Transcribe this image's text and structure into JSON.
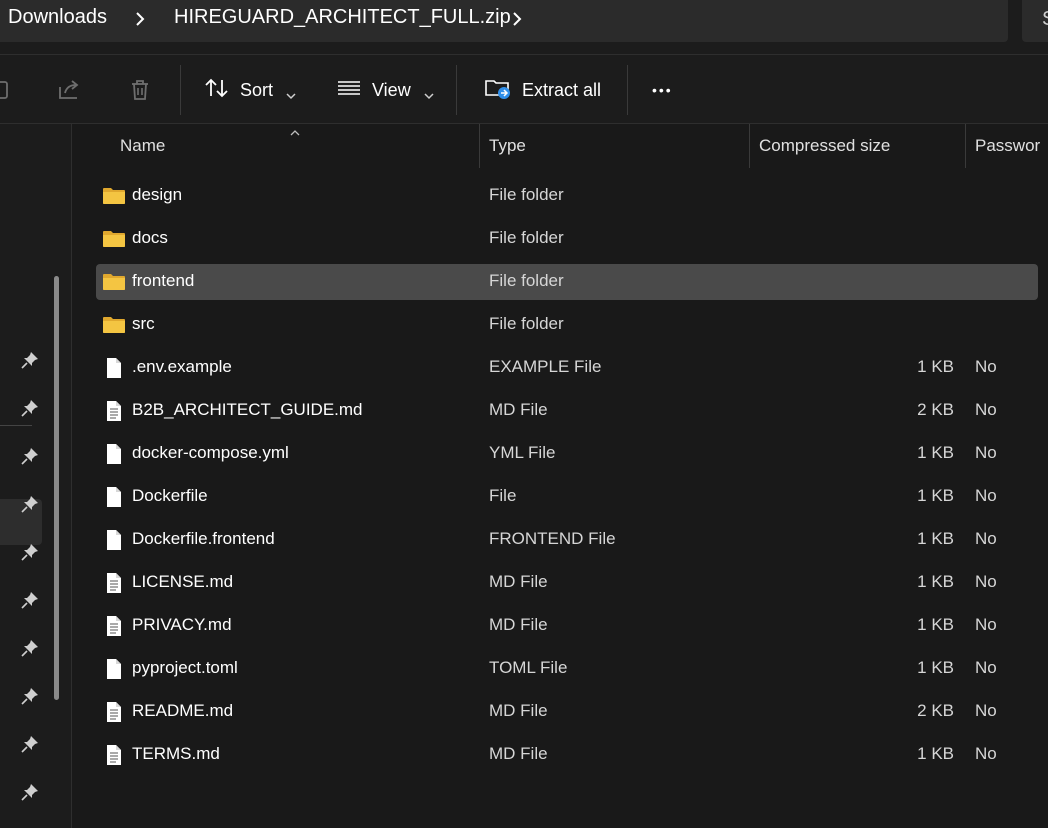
{
  "breadcrumb": {
    "items": [
      "Downloads",
      "HIREGUARD_ARCHITECT_FULL.zip"
    ],
    "search_stub": "S"
  },
  "toolbar": {
    "sort_label": "Sort",
    "view_label": "View",
    "extract_label": "Extract all",
    "more_label": "•••"
  },
  "columns": {
    "name": "Name",
    "type": "Type",
    "compressed_size": "Compressed size",
    "password": "Passwor"
  },
  "files": [
    {
      "name": "design",
      "type": "File folder",
      "size": "",
      "password": "",
      "kind": "folder"
    },
    {
      "name": "docs",
      "type": "File folder",
      "size": "",
      "password": "",
      "kind": "folder"
    },
    {
      "name": "frontend",
      "type": "File folder",
      "size": "",
      "password": "",
      "kind": "folder",
      "selected": true
    },
    {
      "name": "src",
      "type": "File folder",
      "size": "",
      "password": "",
      "kind": "folder"
    },
    {
      "name": ".env.example",
      "type": "EXAMPLE File",
      "size": "1 KB",
      "password": "No",
      "kind": "blank"
    },
    {
      "name": "B2B_ARCHITECT_GUIDE.md",
      "type": "MD File",
      "size": "2 KB",
      "password": "No",
      "kind": "text"
    },
    {
      "name": "docker-compose.yml",
      "type": "YML File",
      "size": "1 KB",
      "password": "No",
      "kind": "blank"
    },
    {
      "name": "Dockerfile",
      "type": "File",
      "size": "1 KB",
      "password": "No",
      "kind": "blank"
    },
    {
      "name": "Dockerfile.frontend",
      "type": "FRONTEND File",
      "size": "1 KB",
      "password": "No",
      "kind": "blank"
    },
    {
      "name": "LICENSE.md",
      "type": "MD File",
      "size": "1 KB",
      "password": "No",
      "kind": "text"
    },
    {
      "name": "PRIVACY.md",
      "type": "MD File",
      "size": "1 KB",
      "password": "No",
      "kind": "text"
    },
    {
      "name": "pyproject.toml",
      "type": "TOML File",
      "size": "1 KB",
      "password": "No",
      "kind": "blank"
    },
    {
      "name": "README.md",
      "type": "MD File",
      "size": "2 KB",
      "password": "No",
      "kind": "text"
    },
    {
      "name": "TERMS.md",
      "type": "MD File",
      "size": "1 KB",
      "password": "No",
      "kind": "text"
    }
  ],
  "colors": {
    "folder": "#f4c542",
    "folder_dark": "#e0a82e",
    "selected_row": "#4a4a4a",
    "background": "#191919"
  },
  "icons": {
    "toolbar": [
      "copy-icon",
      "share-icon",
      "delete-icon",
      "sort-icon",
      "view-icon",
      "extract-icon",
      "more-icon"
    ],
    "sidebar": "pin-icon"
  }
}
